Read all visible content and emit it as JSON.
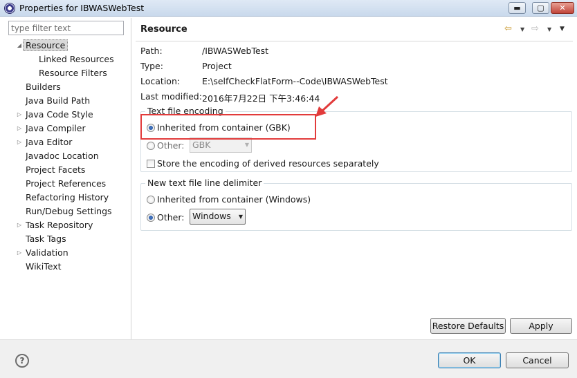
{
  "window": {
    "title": "Properties for IBWASWebTest",
    "minimize_label": "▬",
    "maximize_label": "▢",
    "close_label": "✕"
  },
  "filter": {
    "placeholder": "type filter text"
  },
  "tree": [
    {
      "label": "Resource",
      "expanded": true,
      "selected": true
    },
    {
      "label": "Linked Resources",
      "child": true
    },
    {
      "label": "Resource Filters",
      "child": true
    },
    {
      "label": "Builders"
    },
    {
      "label": "Java Build Path"
    },
    {
      "label": "Java Code Style",
      "collapsed": true
    },
    {
      "label": "Java Compiler",
      "collapsed": true
    },
    {
      "label": "Java Editor",
      "collapsed": true
    },
    {
      "label": "Javadoc Location"
    },
    {
      "label": "Project Facets"
    },
    {
      "label": "Project References"
    },
    {
      "label": "Refactoring History"
    },
    {
      "label": "Run/Debug Settings"
    },
    {
      "label": "Task Repository",
      "collapsed": true
    },
    {
      "label": "Task Tags"
    },
    {
      "label": "Validation",
      "collapsed": true
    },
    {
      "label": "WikiText"
    }
  ],
  "page": {
    "title": "Resource",
    "properties": [
      {
        "label": "Path:",
        "value": "/IBWASWebTest"
      },
      {
        "label": "Type:",
        "value": "Project"
      },
      {
        "label": "Location:",
        "value": "E:\\selfCheckFlatForm--Code\\IBWASWebTest"
      },
      {
        "label": "Last modified:",
        "value": "2016年7月22日 下午3:46:44"
      }
    ],
    "encoding": {
      "group_title": "Text file encoding",
      "inherited_label": "Inherited from container (GBK)",
      "other_label": "Other:",
      "other_value": "GBK",
      "store_label": "Store the encoding of derived resources separately"
    },
    "delimiter": {
      "group_title": "New text file line delimiter",
      "inherited_label": "Inherited from container (Windows)",
      "other_label": "Other:",
      "other_value": "Windows"
    },
    "restore_label": "Restore Defaults",
    "apply_label": "Apply"
  },
  "footer": {
    "help_label": "?",
    "ok_label": "OK",
    "cancel_label": "Cancel"
  },
  "colors": {
    "annotation": "#e23b3b",
    "selection": "#d9d9d9"
  }
}
